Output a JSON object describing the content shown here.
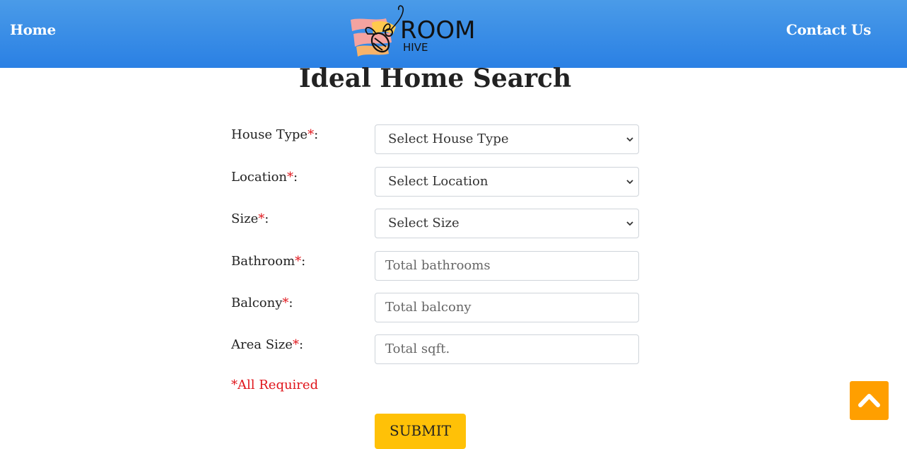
{
  "nav": {
    "home_label": "Home",
    "contact_label": "Contact Us",
    "logo": {
      "word1": "ROOM",
      "word2": "HIVE"
    }
  },
  "page": {
    "title": "Ideal Home Search"
  },
  "form": {
    "house_type": {
      "label": "House Type",
      "value": "Select House Type"
    },
    "location": {
      "label": "Location",
      "value": "Select Location"
    },
    "size": {
      "label": "Size",
      "value": "Select Size"
    },
    "bathroom": {
      "label": "Bathroom",
      "placeholder": "Total bathrooms"
    },
    "balcony": {
      "label": "Balcony",
      "placeholder": "Total balcony"
    },
    "area_size": {
      "label": "Area Size",
      "placeholder": "Total sqft."
    },
    "required_mark": "*",
    "colon": ":",
    "required_note": "*All Required",
    "submit_label": "SUBMIT"
  },
  "colors": {
    "navbar": "#2a80e4",
    "required": "#e0141a",
    "submit": "#ffc107",
    "scroll_top": "#ff9f00"
  },
  "icons": {
    "scroll_top": "chevron-up-icon",
    "select": "chevron-down-icon"
  }
}
